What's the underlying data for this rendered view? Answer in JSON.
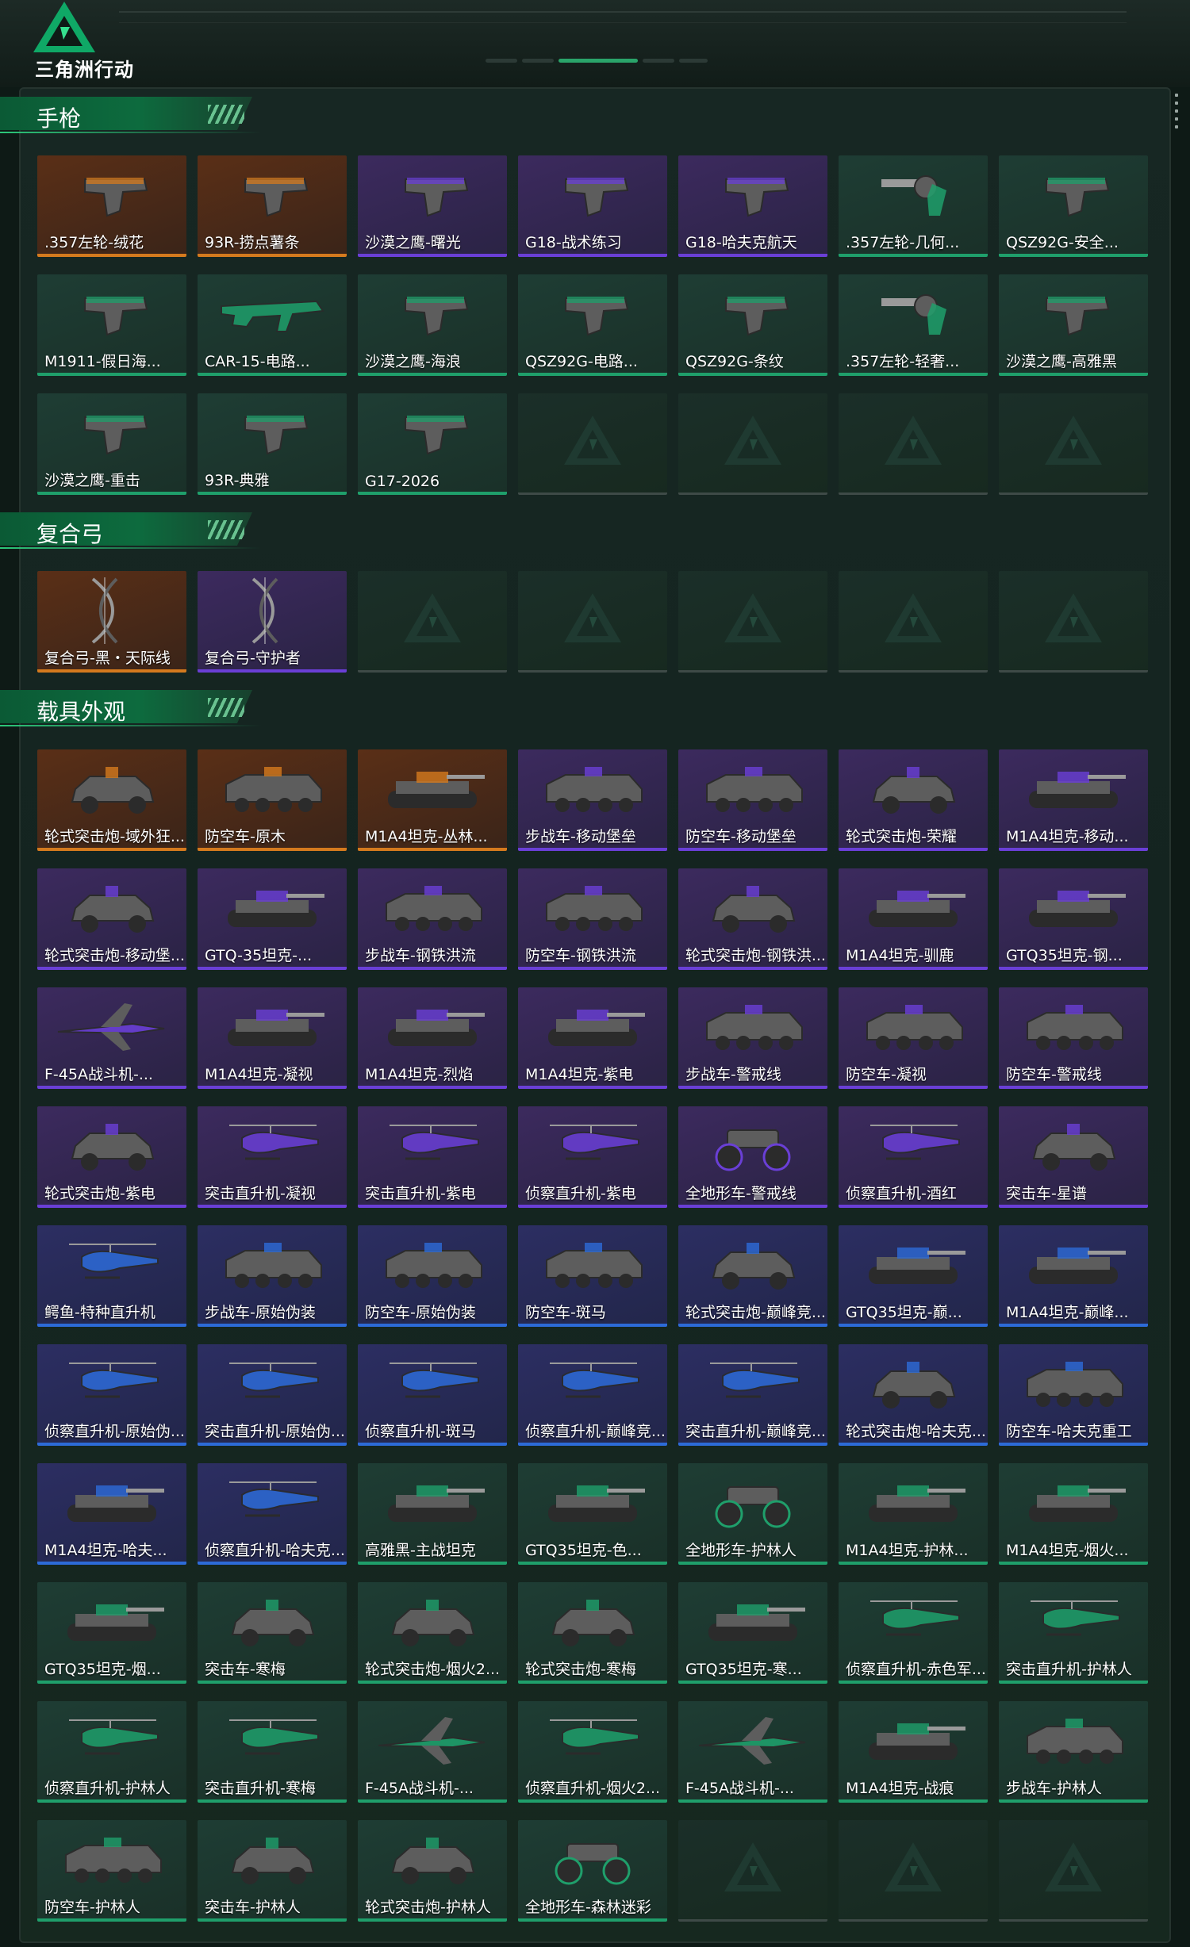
{
  "app": {
    "brand": "三角洲行动"
  },
  "colors": {
    "gold": "#d47a1e",
    "purple": "#6a3fd6",
    "blue": "#2d6bd8",
    "green": "#1f9f6b"
  },
  "sections": [
    {
      "title": "手枪",
      "items": [
        {
          "label": ".357左轮-绒花",
          "rarity": "gold",
          "kind": "pistol"
        },
        {
          "label": "93R-捞点薯条",
          "rarity": "gold",
          "kind": "pistol"
        },
        {
          "label": "沙漠之鹰-曙光",
          "rarity": "purple",
          "kind": "pistol"
        },
        {
          "label": "G18-战术练习",
          "rarity": "purple",
          "kind": "pistol"
        },
        {
          "label": "G18-哈夫克航天",
          "rarity": "purple",
          "kind": "pistol"
        },
        {
          "label": ".357左轮-几何...",
          "rarity": "green",
          "kind": "revolver"
        },
        {
          "label": "QSZ92G-安全...",
          "rarity": "green",
          "kind": "pistol"
        },
        {
          "label": "M1911-假日海...",
          "rarity": "green",
          "kind": "pistol"
        },
        {
          "label": "CAR-15-电路...",
          "rarity": "green",
          "kind": "rifle"
        },
        {
          "label": "沙漠之鹰-海浪",
          "rarity": "green",
          "kind": "pistol"
        },
        {
          "label": "QSZ92G-电路...",
          "rarity": "green",
          "kind": "pistol"
        },
        {
          "label": "QSZ92G-条纹",
          "rarity": "green",
          "kind": "pistol"
        },
        {
          "label": ".357左轮-轻奢...",
          "rarity": "green",
          "kind": "revolver"
        },
        {
          "label": "沙漠之鹰-高雅黑",
          "rarity": "green",
          "kind": "pistol"
        },
        {
          "label": "沙漠之鹰-重击",
          "rarity": "green",
          "kind": "pistol"
        },
        {
          "label": "93R-典雅",
          "rarity": "green",
          "kind": "pistol"
        },
        {
          "label": "G17-2026",
          "rarity": "green",
          "kind": "pistol"
        }
      ],
      "empty_slots": 4
    },
    {
      "title": "复合弓",
      "items": [
        {
          "label": "复合弓-黑・天际线",
          "rarity": "gold",
          "kind": "bow"
        },
        {
          "label": "复合弓-守护者",
          "rarity": "purple",
          "kind": "bow"
        }
      ],
      "empty_slots": 5
    },
    {
      "title": "载具外观",
      "items": [
        {
          "label": "轮式突击炮-域外狂...",
          "rarity": "gold",
          "kind": "car"
        },
        {
          "label": "防空车-原木",
          "rarity": "gold",
          "kind": "apc"
        },
        {
          "label": "M1A4坦克-丛林...",
          "rarity": "gold",
          "kind": "tank"
        },
        {
          "label": "步战车-移动堡垒",
          "rarity": "purple",
          "kind": "apc"
        },
        {
          "label": "防空车-移动堡垒",
          "rarity": "purple",
          "kind": "apc"
        },
        {
          "label": "轮式突击炮-荣耀",
          "rarity": "purple",
          "kind": "car"
        },
        {
          "label": "M1A4坦克-移动...",
          "rarity": "purple",
          "kind": "tank"
        },
        {
          "label": "轮式突击炮-移动堡...",
          "rarity": "purple",
          "kind": "car"
        },
        {
          "label": "GTQ-35坦克-...",
          "rarity": "purple",
          "kind": "tank"
        },
        {
          "label": "步战车-钢铁洪流",
          "rarity": "purple",
          "kind": "apc"
        },
        {
          "label": "防空车-钢铁洪流",
          "rarity": "purple",
          "kind": "apc"
        },
        {
          "label": "轮式突击炮-钢铁洪...",
          "rarity": "purple",
          "kind": "car"
        },
        {
          "label": "M1A4坦克-驯鹿",
          "rarity": "purple",
          "kind": "tank"
        },
        {
          "label": "GTQ35坦克-钢...",
          "rarity": "purple",
          "kind": "tank"
        },
        {
          "label": "F-45A战斗机-...",
          "rarity": "purple",
          "kind": "jet"
        },
        {
          "label": "M1A4坦克-凝视",
          "rarity": "purple",
          "kind": "tank"
        },
        {
          "label": "M1A4坦克-烈焰",
          "rarity": "purple",
          "kind": "tank"
        },
        {
          "label": "M1A4坦克-紫电",
          "rarity": "purple",
          "kind": "tank"
        },
        {
          "label": "步战车-警戒线",
          "rarity": "purple",
          "kind": "apc"
        },
        {
          "label": "防空车-凝视",
          "rarity": "purple",
          "kind": "apc"
        },
        {
          "label": "防空车-警戒线",
          "rarity": "purple",
          "kind": "apc"
        },
        {
          "label": "轮式突击炮-紫电",
          "rarity": "purple",
          "kind": "car"
        },
        {
          "label": "突击直升机-凝视",
          "rarity": "purple",
          "kind": "heli"
        },
        {
          "label": "突击直升机-紫电",
          "rarity": "purple",
          "kind": "heli"
        },
        {
          "label": "侦察直升机-紫电",
          "rarity": "purple",
          "kind": "heli"
        },
        {
          "label": "全地形车-警戒线",
          "rarity": "purple",
          "kind": "atv"
        },
        {
          "label": "侦察直升机-酒红",
          "rarity": "purple",
          "kind": "heli"
        },
        {
          "label": "突击车-星谱",
          "rarity": "purple",
          "kind": "car"
        },
        {
          "label": "鳄鱼-特种直升机",
          "rarity": "blue",
          "kind": "heli"
        },
        {
          "label": "步战车-原始伪装",
          "rarity": "blue",
          "kind": "apc"
        },
        {
          "label": "防空车-原始伪装",
          "rarity": "blue",
          "kind": "apc"
        },
        {
          "label": "防空车-斑马",
          "rarity": "blue",
          "kind": "apc"
        },
        {
          "label": "轮式突击炮-巅峰竞...",
          "rarity": "blue",
          "kind": "car"
        },
        {
          "label": "GTQ35坦克-巅...",
          "rarity": "blue",
          "kind": "tank"
        },
        {
          "label": "M1A4坦克-巅峰...",
          "rarity": "blue",
          "kind": "tank"
        },
        {
          "label": "侦察直升机-原始伪...",
          "rarity": "blue",
          "kind": "heli"
        },
        {
          "label": "突击直升机-原始伪...",
          "rarity": "blue",
          "kind": "heli"
        },
        {
          "label": "侦察直升机-斑马",
          "rarity": "blue",
          "kind": "heli"
        },
        {
          "label": "侦察直升机-巅峰竞...",
          "rarity": "blue",
          "kind": "heli"
        },
        {
          "label": "突击直升机-巅峰竞...",
          "rarity": "blue",
          "kind": "heli"
        },
        {
          "label": "轮式突击炮-哈夫克...",
          "rarity": "blue",
          "kind": "car"
        },
        {
          "label": "防空车-哈夫克重工",
          "rarity": "blue",
          "kind": "apc"
        },
        {
          "label": "M1A4坦克-哈夫...",
          "rarity": "blue",
          "kind": "tank"
        },
        {
          "label": "侦察直升机-哈夫克...",
          "rarity": "blue",
          "kind": "heli"
        },
        {
          "label": "高雅黑-主战坦克",
          "rarity": "green",
          "kind": "tank"
        },
        {
          "label": "GTQ35坦克-色...",
          "rarity": "green",
          "kind": "tank"
        },
        {
          "label": "全地形车-护林人",
          "rarity": "green",
          "kind": "atv"
        },
        {
          "label": "M1A4坦克-护林...",
          "rarity": "green",
          "kind": "tank"
        },
        {
          "label": "M1A4坦克-烟火...",
          "rarity": "green",
          "kind": "tank"
        },
        {
          "label": "GTQ35坦克-烟...",
          "rarity": "green",
          "kind": "tank"
        },
        {
          "label": "突击车-寒梅",
          "rarity": "green",
          "kind": "car"
        },
        {
          "label": "轮式突击炮-烟火2...",
          "rarity": "green",
          "kind": "car"
        },
        {
          "label": "轮式突击炮-寒梅",
          "rarity": "green",
          "kind": "car"
        },
        {
          "label": "GTQ35坦克-寒...",
          "rarity": "green",
          "kind": "tank"
        },
        {
          "label": "侦察直升机-赤色军...",
          "rarity": "green",
          "kind": "heli"
        },
        {
          "label": "突击直升机-护林人",
          "rarity": "green",
          "kind": "heli"
        },
        {
          "label": "侦察直升机-护林人",
          "rarity": "green",
          "kind": "heli"
        },
        {
          "label": "突击直升机-寒梅",
          "rarity": "green",
          "kind": "heli"
        },
        {
          "label": "F-45A战斗机-...",
          "rarity": "green",
          "kind": "jet"
        },
        {
          "label": "侦察直升机-烟火2...",
          "rarity": "green",
          "kind": "heli"
        },
        {
          "label": "F-45A战斗机-...",
          "rarity": "green",
          "kind": "jet"
        },
        {
          "label": "M1A4坦克-战痕",
          "rarity": "green",
          "kind": "tank"
        },
        {
          "label": "步战车-护林人",
          "rarity": "green",
          "kind": "apc"
        },
        {
          "label": "防空车-护林人",
          "rarity": "green",
          "kind": "apc"
        },
        {
          "label": "突击车-护林人",
          "rarity": "green",
          "kind": "car"
        },
        {
          "label": "轮式突击炮-护林人",
          "rarity": "green",
          "kind": "car"
        },
        {
          "label": "全地形车-森林迷彩",
          "rarity": "green",
          "kind": "atv"
        }
      ],
      "empty_slots": 3
    }
  ]
}
